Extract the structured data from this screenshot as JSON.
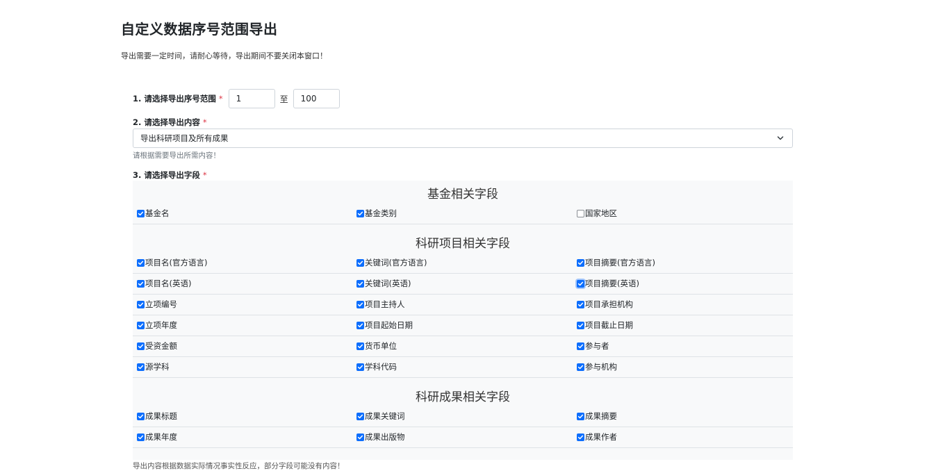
{
  "header": {
    "title": "自定义数据序号范围导出",
    "subtitle": "导出需要一定时间，请耐心等待，导出期间不要关闭本窗口！"
  },
  "step1": {
    "label": "1. 请选择导出序号范围",
    "required": "*",
    "from_value": "1",
    "to_label": "至",
    "to_value": "100"
  },
  "step2": {
    "label": "2. 请选择导出内容",
    "required": "*",
    "selected": "导出科研项目及所有成果",
    "hint": "请根据需要导出所需内容！"
  },
  "step3": {
    "label": "3. 请选择导出字段",
    "required": "*"
  },
  "sections": [
    {
      "title": "基金相关字段",
      "rows": [
        [
          {
            "label": "基金名",
            "checked": true
          },
          {
            "label": "基金类别",
            "checked": true
          },
          {
            "label": "国家地区",
            "checked": false
          }
        ]
      ]
    },
    {
      "title": "科研项目相关字段",
      "rows": [
        [
          {
            "label": "项目名(官方语言)",
            "checked": true
          },
          {
            "label": "关键词(官方语言)",
            "checked": true
          },
          {
            "label": "项目摘要(官方语言)",
            "checked": true
          }
        ],
        [
          {
            "label": "项目名(英语)",
            "checked": true
          },
          {
            "label": "关键词(英语)",
            "checked": true
          },
          {
            "label": "项目摘要(英语)",
            "checked": true
          }
        ],
        [
          {
            "label": "立项编号",
            "checked": true
          },
          {
            "label": "项目主持人",
            "checked": true
          },
          {
            "label": "项目承担机构",
            "checked": true
          }
        ],
        [
          {
            "label": "立项年度",
            "checked": true
          },
          {
            "label": "项目起始日期",
            "checked": true
          },
          {
            "label": "项目截止日期",
            "checked": true
          }
        ],
        [
          {
            "label": "受资金额",
            "checked": true
          },
          {
            "label": "货币单位",
            "checked": true
          },
          {
            "label": "参与者",
            "checked": true
          }
        ],
        [
          {
            "label": "源学科",
            "checked": true
          },
          {
            "label": "学科代码",
            "checked": true
          },
          {
            "label": "参与机构",
            "checked": true
          }
        ]
      ]
    },
    {
      "title": "科研成果相关字段",
      "rows": [
        [
          {
            "label": "成果标题",
            "checked": true
          },
          {
            "label": "成果关键词",
            "checked": true
          },
          {
            "label": "成果摘要",
            "checked": true
          }
        ],
        [
          {
            "label": "成果年度",
            "checked": true
          },
          {
            "label": "成果出版物",
            "checked": true
          },
          {
            "label": "成果作者",
            "checked": true
          }
        ]
      ]
    }
  ],
  "footnote": "导出内容根据数据实际情况事实性反应，部分字段可能没有内容！",
  "colors": {
    "accent": "#0d6efd",
    "required": "#dc3545",
    "panel_bg": "#f8f9fa"
  }
}
